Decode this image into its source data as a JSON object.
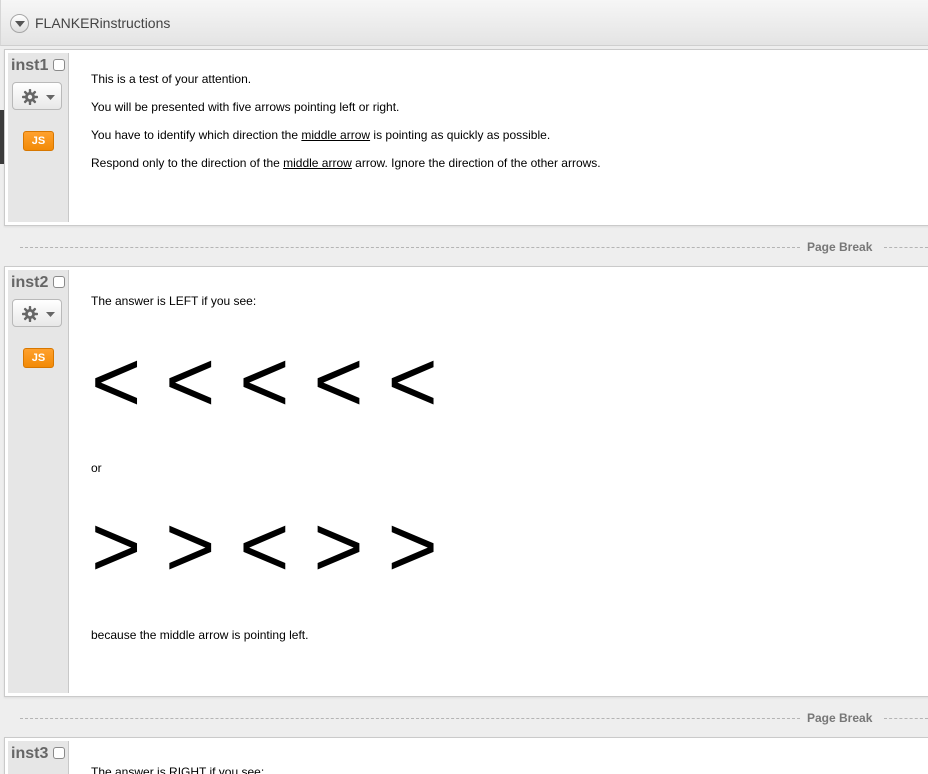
{
  "block": {
    "title": "FLANKERinstructions"
  },
  "questions": [
    {
      "id": "inst1",
      "js_label": "JS",
      "lines": [
        {
          "text": "This is a test of your attention."
        },
        {
          "text": "You will be presented with five arrows pointing left or right."
        },
        {
          "pre": "You have to identify which direction the ",
          "u": "middle arrow",
          "post": " is pointing as quickly as possible."
        },
        {
          "pre": "Respond only to the direction of the ",
          "u": "middle arrow",
          "post": " arrow. Ignore the direction of the other arrows."
        }
      ]
    },
    {
      "id": "inst2",
      "js_label": "JS",
      "intro": "The answer is LEFT if you see:",
      "arrows_a": "< < < < <",
      "or": "or",
      "arrows_b": "> > < > >",
      "outro": "because the middle arrow is pointing left."
    },
    {
      "id": "inst3",
      "intro": "The answer is RIGHT if you see:"
    }
  ],
  "page_break_label": "Page Break",
  "icons": {
    "collapse": "chevron-down-circle-icon",
    "gear": "gear-icon",
    "checkbox": "checkbox-icon"
  },
  "colors": {
    "js_badge": "#f28a06",
    "panel_side": "#e6e6e6"
  }
}
